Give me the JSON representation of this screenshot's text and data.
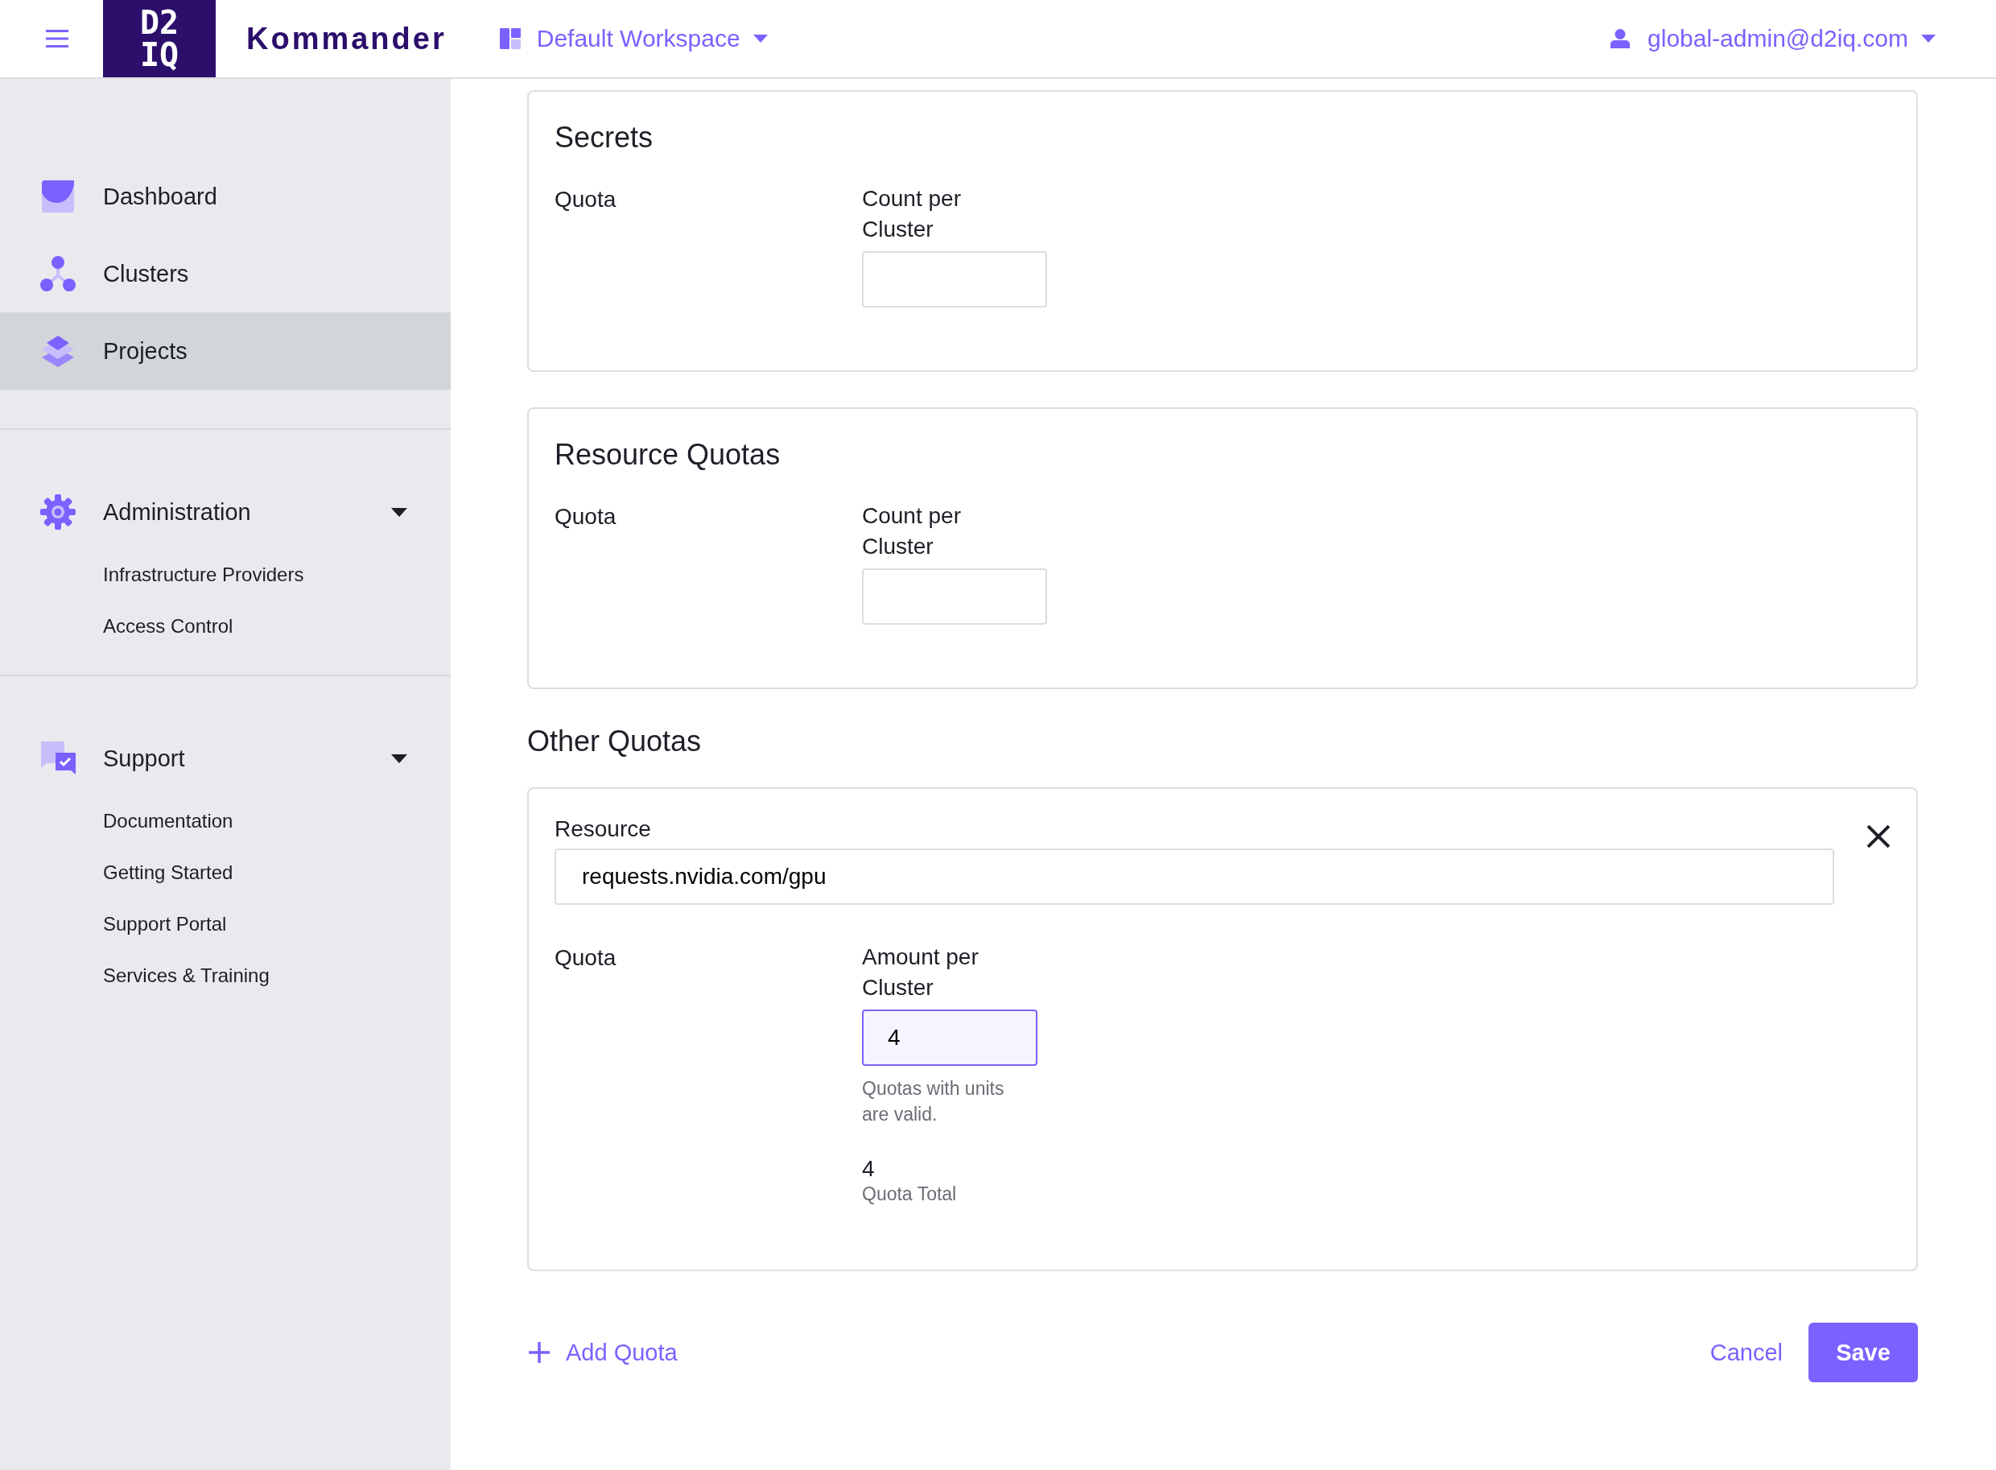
{
  "topbar": {
    "logo_top": "D2",
    "logo_bottom": "IQ",
    "product": "Kommander",
    "workspace": "Default Workspace",
    "user": "global-admin@d2iq.com"
  },
  "sidebar": {
    "groups": [
      {
        "items": [
          {
            "label": "Dashboard",
            "selected": false
          },
          {
            "label": "Clusters",
            "selected": false
          },
          {
            "label": "Projects",
            "selected": true
          }
        ]
      },
      {
        "title": "Administration",
        "expanded": true,
        "items": [
          "Infrastructure Providers",
          "Access Control"
        ]
      },
      {
        "title": "Support",
        "expanded": true,
        "items": [
          "Documentation",
          "Getting Started",
          "Support Portal",
          "Services & Training"
        ]
      }
    ]
  },
  "quota_cards": [
    {
      "title": "Secrets",
      "row_label": "Quota",
      "field_label": "Count per Cluster"
    },
    {
      "title": "Resource Quotas",
      "row_label": "Quota",
      "field_label": "Count per Cluster"
    }
  ],
  "other_quotas": {
    "title": "Other Quotas",
    "items": [
      {
        "resource_label": "Resource",
        "resource": "requests.nvidia.com/gpu",
        "row_label": "Quota",
        "field_label": "Amount per Cluster",
        "value": "4",
        "focused": true,
        "hint": "Quotas with units are valid.",
        "total": "4",
        "total_label": "Quota Total"
      }
    ]
  },
  "actions": {
    "add": "Add Quota",
    "cancel": "Cancel",
    "save": "Save"
  }
}
